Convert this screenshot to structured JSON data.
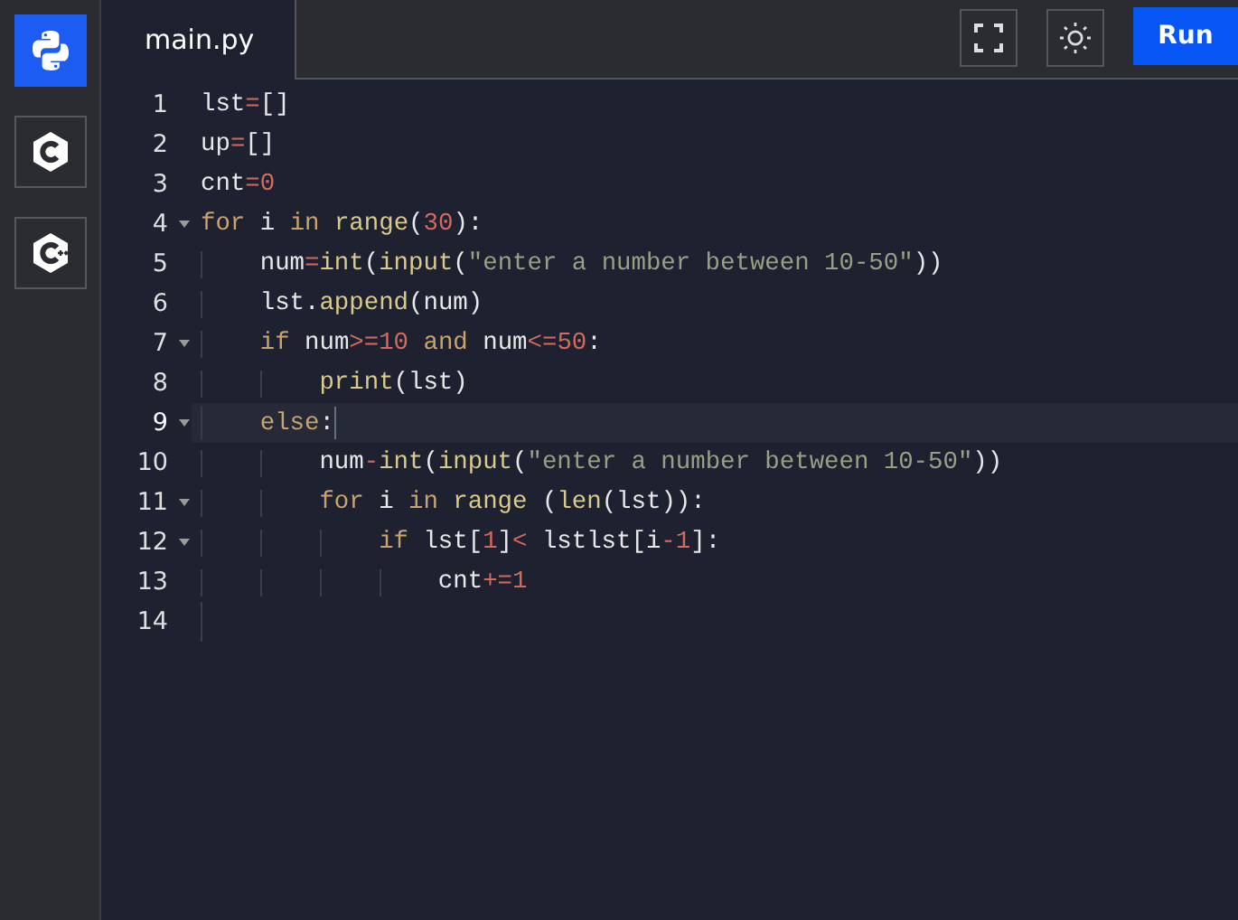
{
  "sidebar": {
    "items": [
      {
        "kind": "python",
        "selected": true
      },
      {
        "kind": "c",
        "selected": false
      },
      {
        "kind": "cpp",
        "selected": false
      }
    ]
  },
  "tabs": [
    {
      "label": "main.py",
      "selected": true
    }
  ],
  "toolbar": {
    "run_label": "Run"
  },
  "editor": {
    "lines": [
      {
        "number": "1",
        "foldable": false,
        "active": false,
        "tokens": [
          {
            "kind": "plain",
            "text": "lst"
          },
          {
            "kind": "op",
            "text": "="
          },
          {
            "kind": "plain",
            "text": "[]"
          }
        ]
      },
      {
        "number": "2",
        "foldable": false,
        "active": false,
        "tokens": [
          {
            "kind": "plain",
            "text": "up"
          },
          {
            "kind": "op",
            "text": "="
          },
          {
            "kind": "plain",
            "text": "[]"
          }
        ]
      },
      {
        "number": "3",
        "foldable": false,
        "active": false,
        "tokens": [
          {
            "kind": "plain",
            "text": "cnt"
          },
          {
            "kind": "op",
            "text": "="
          },
          {
            "kind": "num",
            "text": "0"
          }
        ]
      },
      {
        "number": "4",
        "foldable": true,
        "active": false,
        "tokens": [
          {
            "kind": "kw",
            "text": "for"
          },
          {
            "kind": "plain",
            "text": " i "
          },
          {
            "kind": "kw",
            "text": "in"
          },
          {
            "kind": "fn",
            "text": " range"
          },
          {
            "kind": "plain",
            "text": "("
          },
          {
            "kind": "num",
            "text": "30"
          },
          {
            "kind": "plain",
            "text": "):"
          }
        ]
      },
      {
        "number": "5",
        "foldable": false,
        "active": false,
        "tokens": [
          {
            "kind": "plain",
            "text": "    num"
          },
          {
            "kind": "op",
            "text": "="
          },
          {
            "kind": "fn",
            "text": "int"
          },
          {
            "kind": "plain",
            "text": "("
          },
          {
            "kind": "fn",
            "text": "input"
          },
          {
            "kind": "plain",
            "text": "("
          },
          {
            "kind": "str",
            "text": "\"enter a number between 10-50\""
          },
          {
            "kind": "plain",
            "text": "))"
          }
        ]
      },
      {
        "number": "6",
        "foldable": false,
        "active": false,
        "tokens": [
          {
            "kind": "plain",
            "text": "    lst."
          },
          {
            "kind": "fn",
            "text": "append"
          },
          {
            "kind": "plain",
            "text": "(num)"
          }
        ]
      },
      {
        "number": "7",
        "foldable": true,
        "active": false,
        "tokens": [
          {
            "kind": "kw",
            "text": "    if"
          },
          {
            "kind": "plain",
            "text": " num"
          },
          {
            "kind": "op",
            "text": ">="
          },
          {
            "kind": "num",
            "text": "10"
          },
          {
            "kind": "kw",
            "text": " and"
          },
          {
            "kind": "plain",
            "text": " num"
          },
          {
            "kind": "op",
            "text": "<="
          },
          {
            "kind": "num",
            "text": "50"
          },
          {
            "kind": "plain",
            "text": ":"
          }
        ]
      },
      {
        "number": "8",
        "foldable": false,
        "active": false,
        "tokens": [
          {
            "kind": "fn",
            "text": "        print"
          },
          {
            "kind": "plain",
            "text": "(lst)"
          }
        ]
      },
      {
        "number": "9",
        "foldable": true,
        "active": true,
        "tokens": [
          {
            "kind": "kw",
            "text": "    else"
          },
          {
            "kind": "plain",
            "text": ":"
          }
        ]
      },
      {
        "number": "10",
        "foldable": false,
        "active": false,
        "tokens": [
          {
            "kind": "plain",
            "text": "        num"
          },
          {
            "kind": "op",
            "text": "-"
          },
          {
            "kind": "fn",
            "text": "int"
          },
          {
            "kind": "plain",
            "text": "("
          },
          {
            "kind": "fn",
            "text": "input"
          },
          {
            "kind": "plain",
            "text": "("
          },
          {
            "kind": "str",
            "text": "\"enter a number between 10-50\""
          },
          {
            "kind": "plain",
            "text": "))"
          }
        ]
      },
      {
        "number": "11",
        "foldable": true,
        "active": false,
        "tokens": [
          {
            "kind": "kw",
            "text": "        for"
          },
          {
            "kind": "plain",
            "text": " i "
          },
          {
            "kind": "kw",
            "text": "in"
          },
          {
            "kind": "fn",
            "text": " range"
          },
          {
            "kind": "plain",
            "text": " ("
          },
          {
            "kind": "fn",
            "text": "len"
          },
          {
            "kind": "plain",
            "text": "(lst)):"
          }
        ]
      },
      {
        "number": "12",
        "foldable": true,
        "active": false,
        "tokens": [
          {
            "kind": "kw",
            "text": "            if"
          },
          {
            "kind": "plain",
            "text": " lst["
          },
          {
            "kind": "num",
            "text": "1"
          },
          {
            "kind": "plain",
            "text": "]"
          },
          {
            "kind": "op",
            "text": "<"
          },
          {
            "kind": "plain",
            "text": " lstlst[i"
          },
          {
            "kind": "op",
            "text": "-"
          },
          {
            "kind": "num",
            "text": "1"
          },
          {
            "kind": "plain",
            "text": "]:"
          }
        ]
      },
      {
        "number": "13",
        "foldable": false,
        "active": false,
        "tokens": [
          {
            "kind": "plain",
            "text": "                cnt"
          },
          {
            "kind": "op",
            "text": "+="
          },
          {
            "kind": "num",
            "text": "1"
          }
        ]
      },
      {
        "number": "14",
        "foldable": false,
        "active": false
      }
    ]
  }
}
